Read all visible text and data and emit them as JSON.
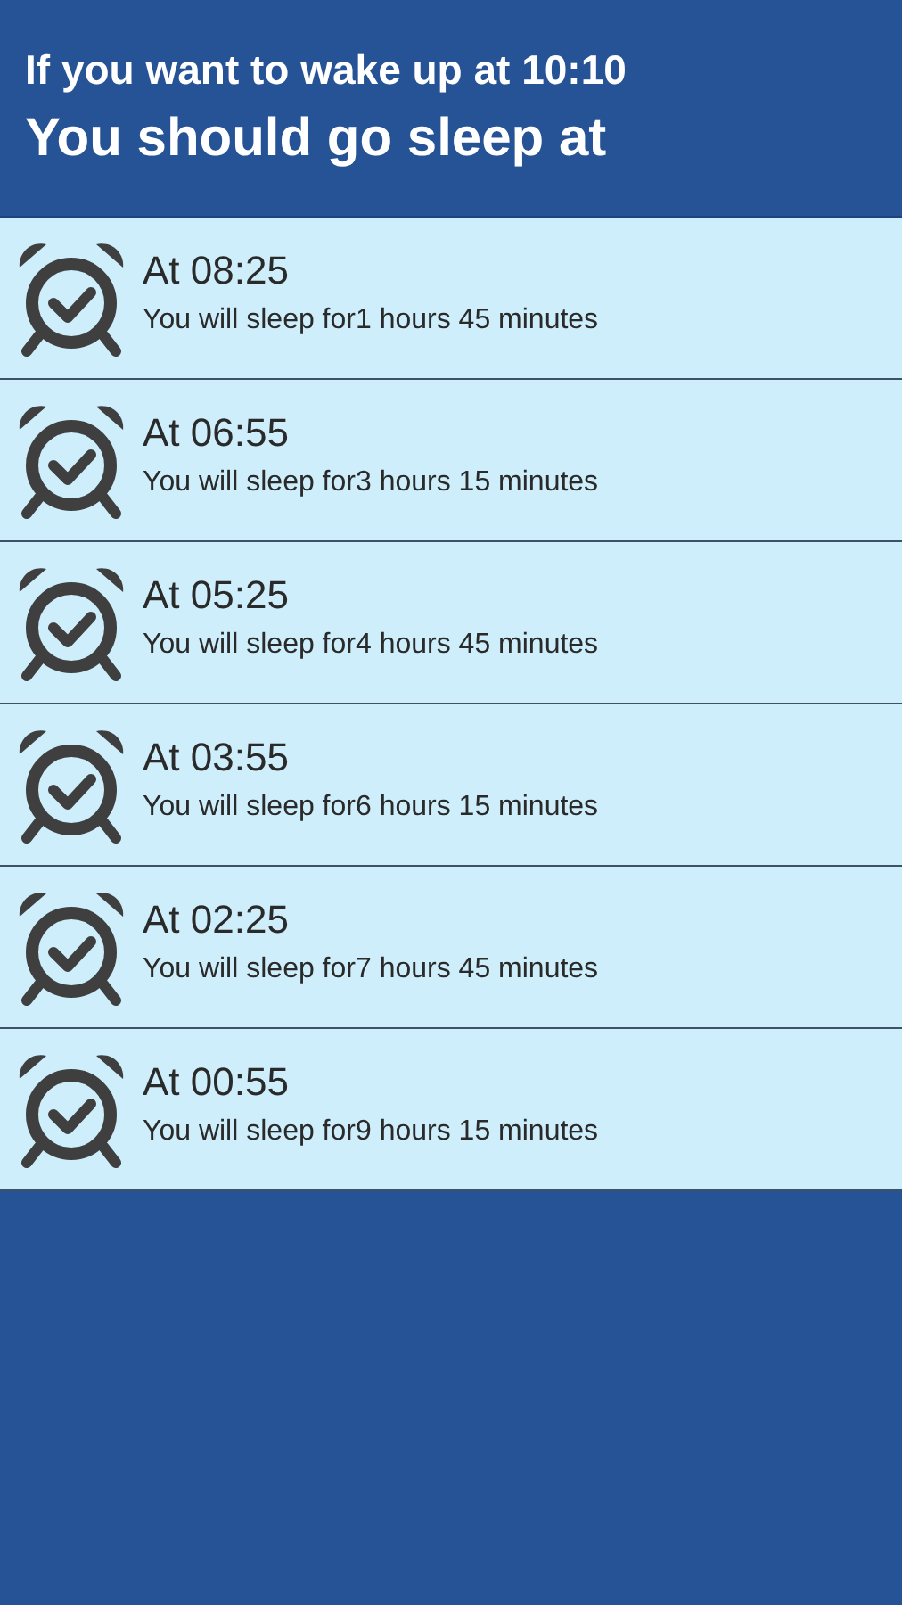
{
  "header": {
    "subtitle": "If you want to wake up at 10:10",
    "title": "You should go sleep at"
  },
  "items": [
    {
      "time": "At 08:25",
      "duration": "You will sleep for1 hours 45 minutes"
    },
    {
      "time": "At 06:55",
      "duration": "You will sleep for3 hours 15 minutes"
    },
    {
      "time": "At 05:25",
      "duration": "You will sleep for4 hours 45 minutes"
    },
    {
      "time": "At 03:55",
      "duration": "You will sleep for6 hours 15 minutes"
    },
    {
      "time": "At 02:25",
      "duration": "You will sleep for7 hours 45 minutes"
    },
    {
      "time": "At 00:55",
      "duration": "You will sleep for9 hours 15 minutes"
    }
  ]
}
